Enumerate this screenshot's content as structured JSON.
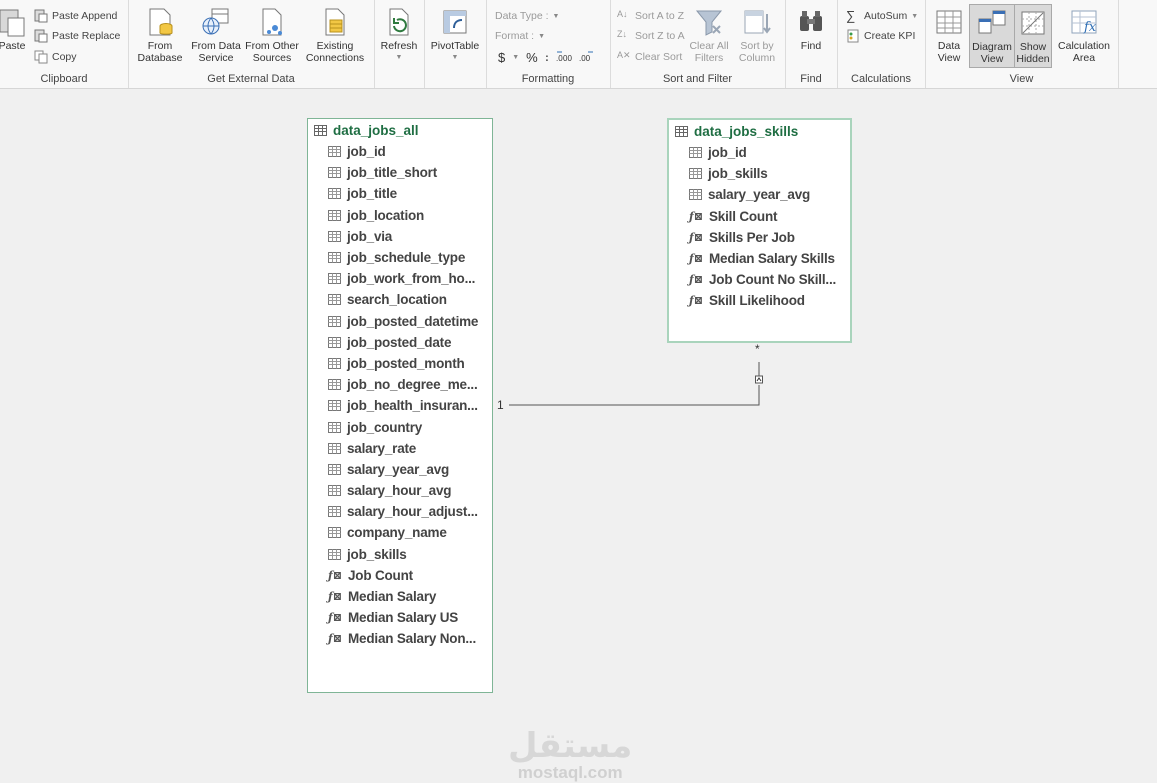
{
  "ribbon": {
    "clipboard": {
      "label": "Clipboard",
      "paste": "Paste",
      "paste_append": "Paste Append",
      "paste_replace": "Paste Replace",
      "copy": "Copy"
    },
    "external": {
      "label": "Get External Data",
      "from_database": "From Database",
      "from_data_service": "From Data Service",
      "from_other_sources": "From Other Sources",
      "existing_connections": "Existing Connections"
    },
    "refresh": "Refresh",
    "pivottable": "PivotTable",
    "formatting": {
      "label": "Formatting",
      "data_type": "Data Type :",
      "format": "Format :",
      "currency": "$",
      "percent": "%",
      "comma": "։"
    },
    "sort_filter": {
      "label": "Sort and Filter",
      "sort_a_z": "Sort A to Z",
      "sort_z_a": "Sort Z to A",
      "clear_sort": "Clear Sort",
      "clear_all_filters": "Clear All Filters",
      "sort_by_column": "Sort by Column"
    },
    "find": {
      "label": "Find",
      "find": "Find"
    },
    "calculations": {
      "label": "Calculations",
      "autosum": "AutoSum",
      "create_kpi": "Create KPI"
    },
    "view": {
      "label": "View",
      "data_view": "Data View",
      "diagram_view": "Diagram View",
      "show_hidden": "Show Hidden",
      "calculation_area": "Calculation Area"
    }
  },
  "tables": {
    "jobs_all": {
      "name": "data_jobs_all",
      "columns": [
        "job_id",
        "job_title_short",
        "job_title",
        "job_location",
        "job_via",
        "job_schedule_type",
        "job_work_from_ho...",
        "search_location",
        "job_posted_datetime",
        "job_posted_date",
        "job_posted_month",
        "job_no_degree_me...",
        "job_health_insuran...",
        "job_country",
        "salary_rate",
        "salary_year_avg",
        "salary_hour_avg",
        "salary_hour_adjust...",
        "company_name",
        "job_skills"
      ],
      "measures": [
        "Job Count",
        "Median Salary",
        "Median Salary US",
        "Median Salary Non..."
      ]
    },
    "jobs_skills": {
      "name": "data_jobs_skills",
      "columns": [
        "job_id",
        "job_skills",
        "salary_year_avg"
      ],
      "measures": [
        "Skill Count",
        "Skills Per Job",
        "Median Salary Skills",
        "Job Count No Skill...",
        "Skill Likelihood"
      ]
    }
  },
  "relationship": {
    "one_side": "1",
    "many_side": "*"
  },
  "watermark": {
    "arabic": "مستقل",
    "latin": "mostaql.com"
  },
  "colors": {
    "table_title": "#1f6e43",
    "table_border": "#a9d4bc",
    "ribbon_bg": "#f8f8f8"
  }
}
